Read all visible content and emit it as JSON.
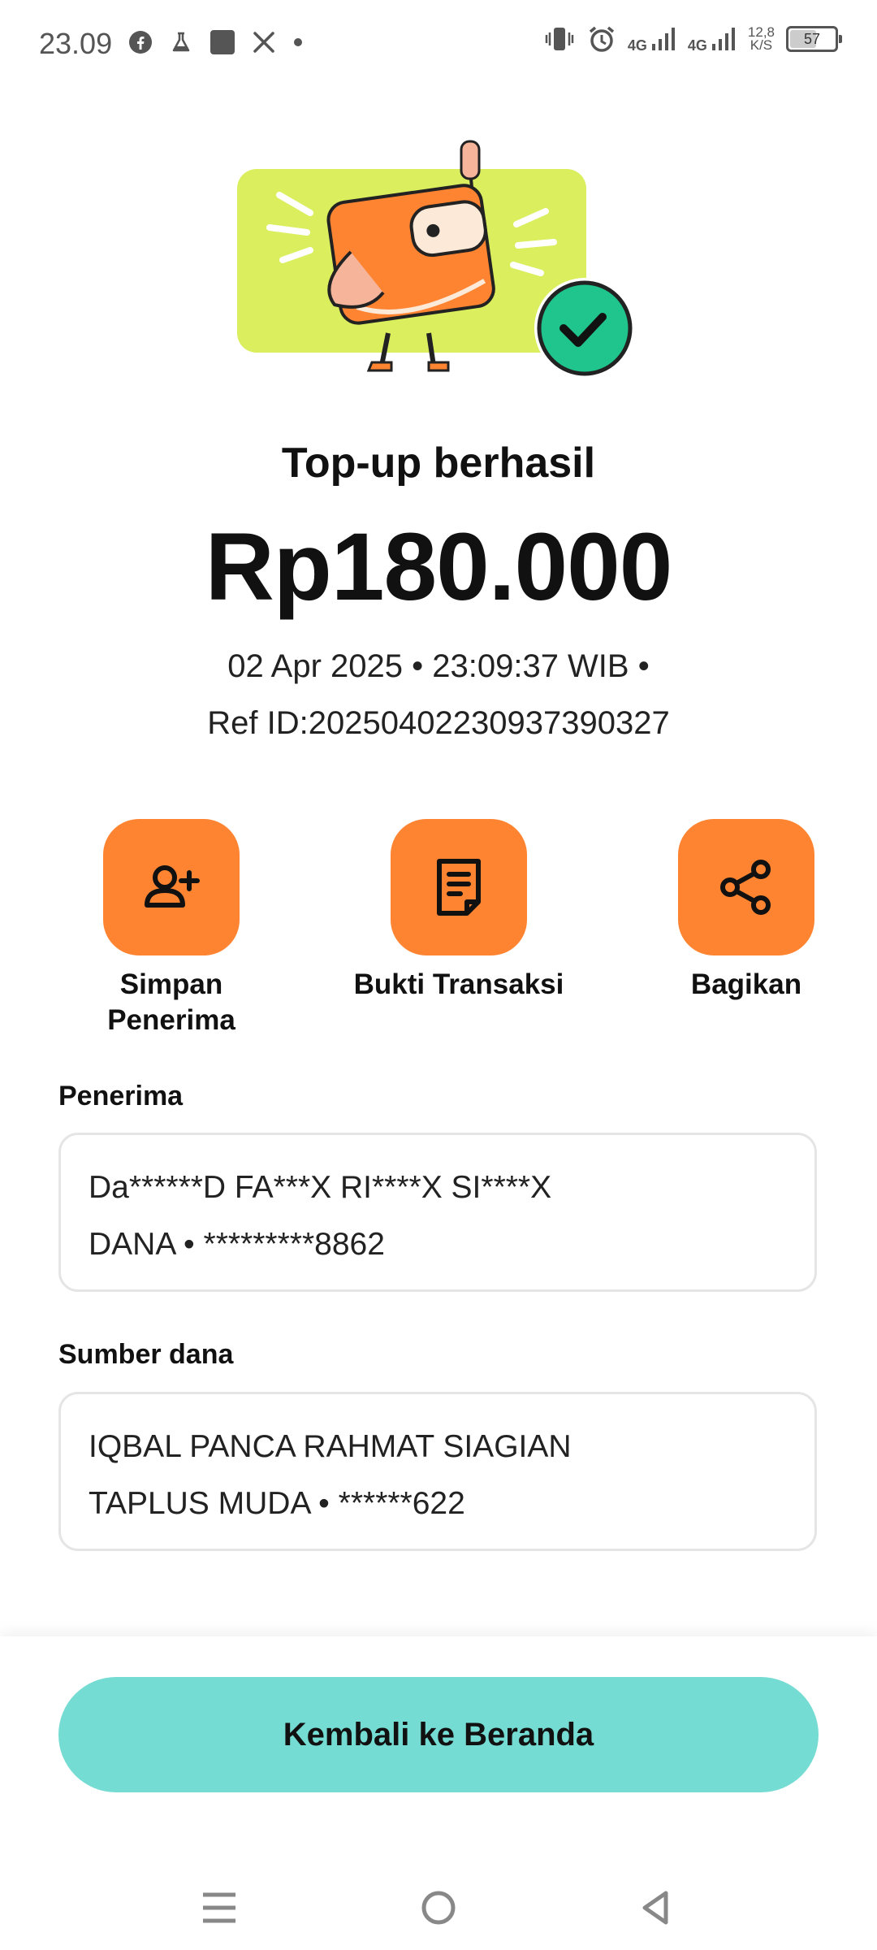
{
  "status_bar": {
    "time": "23.09",
    "network_1": "4G",
    "network_2": "4G",
    "speed_value": "12,8",
    "speed_unit": "K/S",
    "battery": "57"
  },
  "header": {
    "title": "Top-up berhasil",
    "amount": "Rp180.000",
    "datetime_line": "02 Apr 2025 • 23:09:37 WIB •",
    "ref_line": "Ref ID:20250402230937390327"
  },
  "actions": [
    {
      "label_line1": "Simpan",
      "label_line2": "Penerima",
      "icon": "add-user-icon"
    },
    {
      "label_line1": "Bukti Transaksi",
      "label_line2": "",
      "icon": "receipt-icon"
    },
    {
      "label_line1": "Bagikan",
      "label_line2": "",
      "icon": "share-icon"
    }
  ],
  "recipient": {
    "label": "Penerima",
    "name": "Da******D FA***X RI****X SI****X",
    "account": "DANA • *********8862"
  },
  "source": {
    "label": "Sumber dana",
    "name": "IQBAL PANCA RAHMAT SIAGIAN",
    "account": "TAPLUS MUDA • ******622"
  },
  "home_button": "Kembali ke Beranda",
  "colors": {
    "accent_orange": "#ff8431",
    "button_teal": "#74dcd2",
    "hero_lime": "#dbee5e",
    "success_green": "#1fc58c"
  }
}
